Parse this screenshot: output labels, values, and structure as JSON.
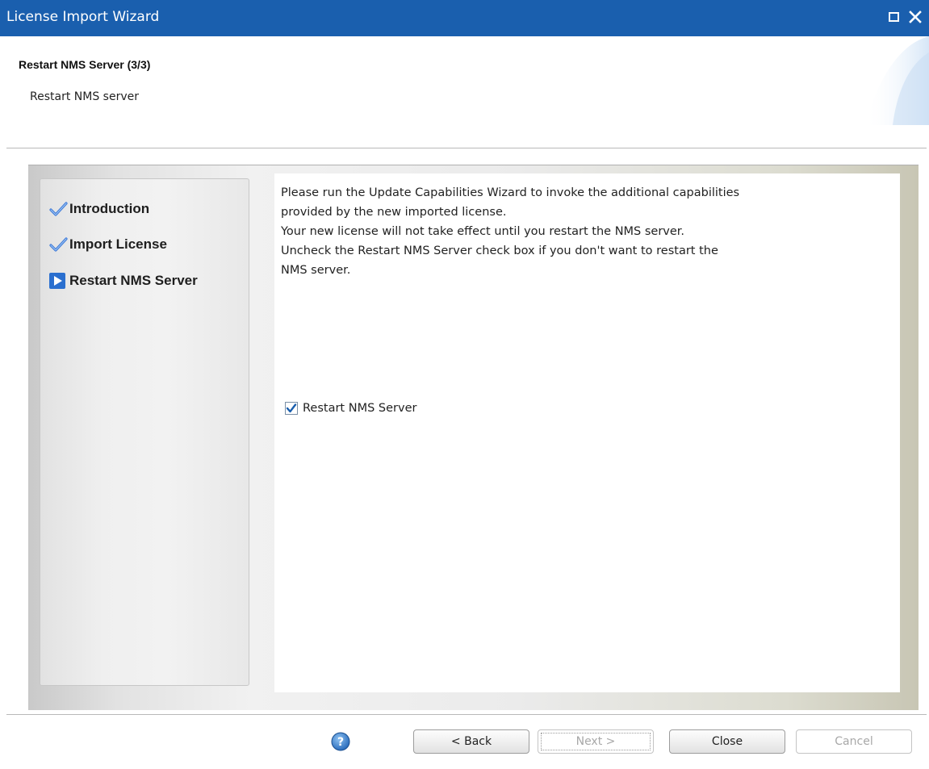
{
  "window": {
    "title": "License Import Wizard",
    "controls": [
      "maximize-icon",
      "close-icon"
    ]
  },
  "header": {
    "step_title": "Restart NMS Server (3/3)",
    "step_description": "Restart NMS server"
  },
  "steps": [
    {
      "label": "Introduction",
      "state": "completed",
      "icon": "checkmark-icon"
    },
    {
      "label": "Import License",
      "state": "completed",
      "icon": "checkmark-icon"
    },
    {
      "label": "Restart NMS Server",
      "state": "current",
      "icon": "play-arrow-icon"
    }
  ],
  "content": {
    "lines": [
      "Please run the Update Capabilities Wizard to invoke the additional capabilities",
      "provided by the new imported license.",
      "Your new license will not take effect until you restart the NMS server.",
      "Uncheck the Restart NMS Server check box if you don't want to restart the",
      "NMS server."
    ],
    "checkbox": {
      "label": "Restart NMS Server",
      "checked": true
    }
  },
  "footer": {
    "help_icon": "help-icon",
    "back_label": "< Back",
    "next_label": "Next >",
    "close_label": "Close",
    "cancel_label": "Cancel"
  },
  "colors": {
    "titlebar": "#1a5fae",
    "accent": "#2a6fcf",
    "disabled_text": "#a8a8a8"
  }
}
